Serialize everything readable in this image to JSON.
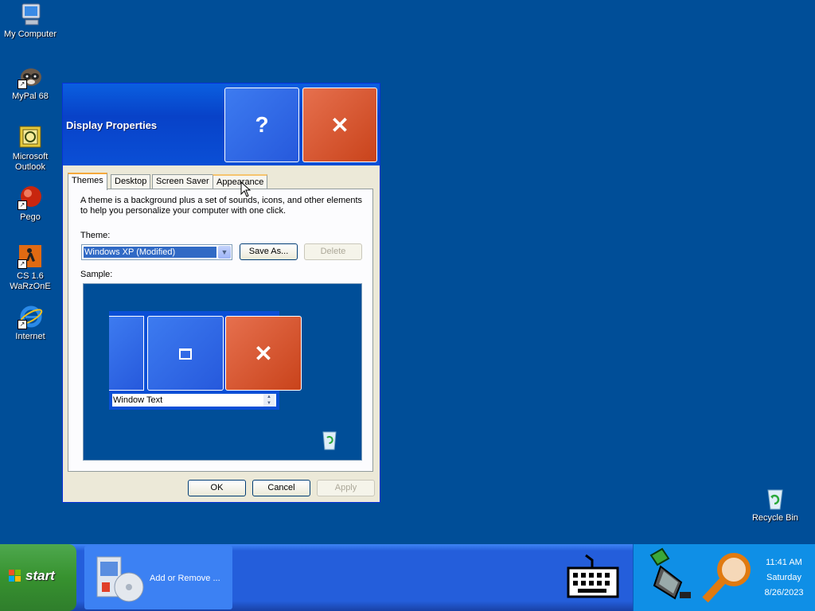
{
  "desktop": {
    "icons": [
      {
        "label": "My Computer"
      },
      {
        "label": "MyPal 68"
      },
      {
        "label": "Microsoft Outlook"
      },
      {
        "label": "Pego"
      },
      {
        "label": "CS 1.6 WaRzOnE"
      },
      {
        "label": "Internet"
      }
    ],
    "recycle_bin": "Recycle Bin"
  },
  "window": {
    "title": "Display Properties",
    "help_glyph": "?",
    "close_glyph": "✕",
    "tabs": [
      "Themes",
      "Desktop",
      "Screen Saver",
      "Appearance"
    ],
    "active_tab": "Themes",
    "description": "A theme is a background plus a set of sounds, icons, and other elements to help you personalize your computer with one click.",
    "theme_label": "Theme:",
    "theme_value": "Windows XP (Modified)",
    "save_as": "Save As...",
    "delete": "Delete",
    "sample_label": "Sample:",
    "sample_window_text": "Window Text",
    "ok": "OK",
    "cancel": "Cancel",
    "apply": "Apply"
  },
  "taskbar": {
    "start_label": "start",
    "task_label": "Add or Remove ...",
    "clock": {
      "time": "11:41 AM",
      "day": "Saturday",
      "date": "8/26/2023"
    }
  }
}
